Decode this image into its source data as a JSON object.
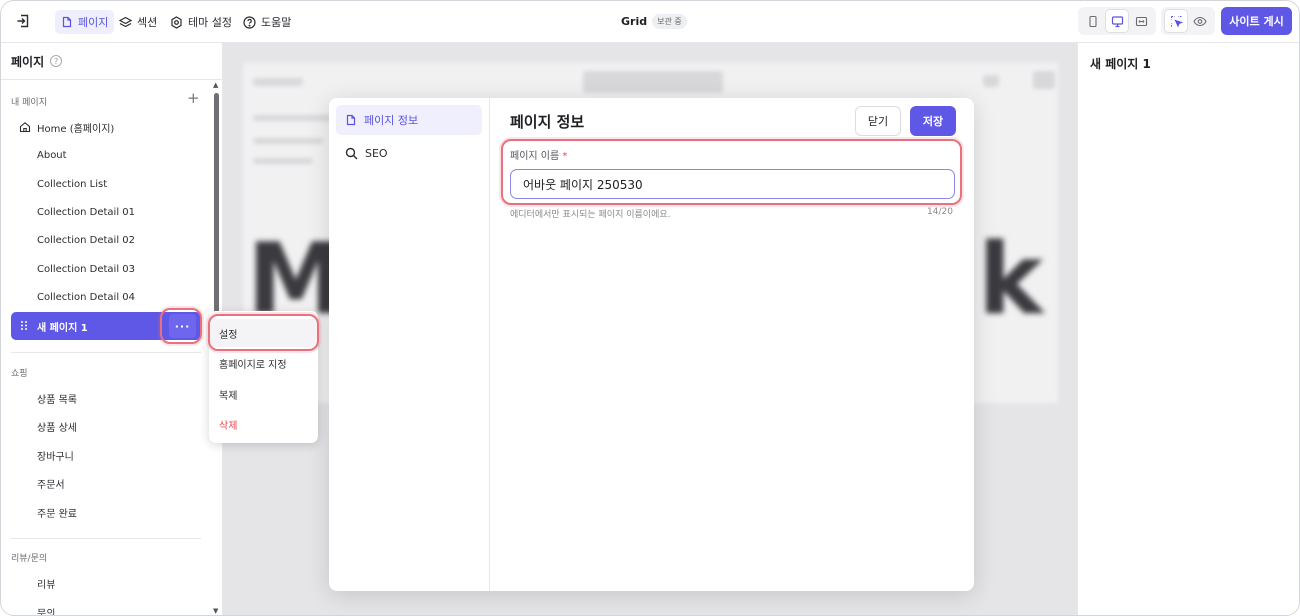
{
  "topbar": {
    "nav": [
      {
        "label": "페이지",
        "icon": "page-icon",
        "active": true
      },
      {
        "label": "섹션",
        "icon": "layers-icon",
        "active": false
      },
      {
        "label": "테마 설정",
        "icon": "gear-icon",
        "active": false
      },
      {
        "label": "도움말",
        "icon": "help-icon",
        "active": false
      }
    ],
    "site_title": "Grid",
    "status_badge": "보관 중",
    "publish_label": "사이트 게시"
  },
  "sidebar": {
    "title": "페이지",
    "groups": [
      {
        "label": "내 페이지",
        "items": [
          "Home (홈페이지)",
          "About",
          "Collection List",
          "Collection Detail 01",
          "Collection Detail 02",
          "Collection Detail 03",
          "Collection Detail 04",
          "새 페이지 1"
        ]
      },
      {
        "label": "쇼핑",
        "items": [
          "상품 목록",
          "상품 상세",
          "장바구니",
          "주문서",
          "주문 완료"
        ]
      },
      {
        "label": "리뷰/문의",
        "items": [
          "리뷰",
          "문의"
        ]
      }
    ],
    "more_label": "···"
  },
  "context_menu": {
    "items": [
      "설정",
      "홈페이지로 지정",
      "복제",
      "삭제"
    ]
  },
  "right_panel": {
    "title": "새 페이지 1"
  },
  "modal": {
    "nav": [
      {
        "label": "페이지 정보",
        "icon": "page-icon"
      },
      {
        "label": "SEO",
        "icon": "search-icon"
      }
    ],
    "title": "페이지 정보",
    "close_label": "닫기",
    "save_label": "저장",
    "field_label": "페이지 이름",
    "required_mark": "*",
    "field_value": "어바웃 페이지 250530",
    "help_text": "에디터에서만 표시되는 페이지 이름이에요.",
    "char_count": "14/20"
  },
  "colors": {
    "accent": "#5f57e6",
    "highlight": "#e8707f",
    "danger": "#e5484d"
  }
}
